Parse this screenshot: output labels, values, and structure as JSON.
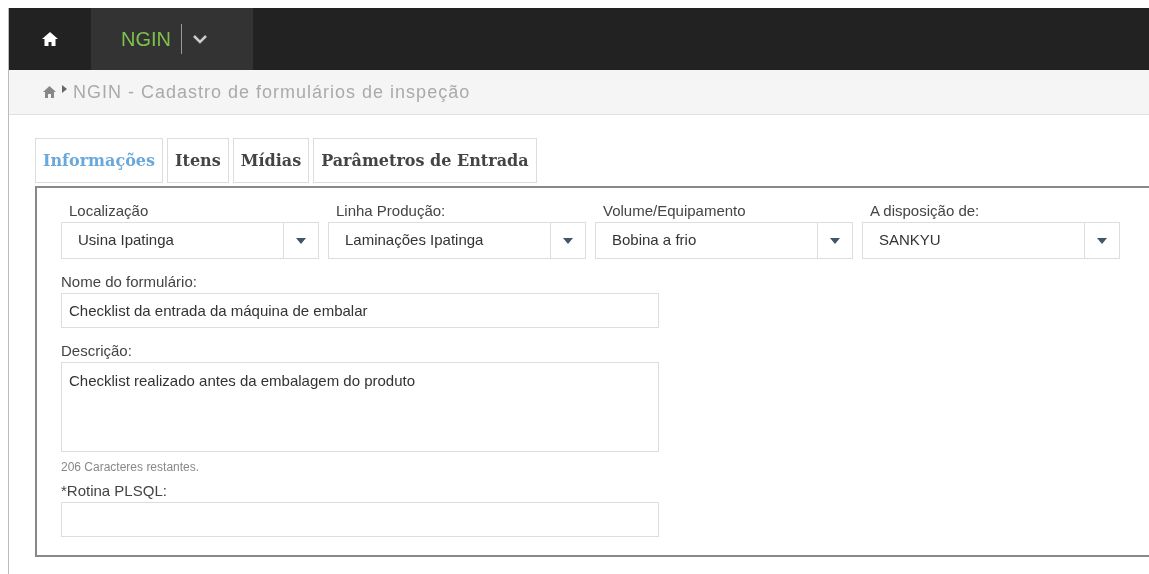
{
  "top_bar": {
    "module": "NGIN"
  },
  "breadcrumb": {
    "text": "NGIN - Cadastro de formulários de inspeção"
  },
  "tabs": [
    {
      "label": "Informações",
      "selected": true
    },
    {
      "label": "Itens",
      "selected": false
    },
    {
      "label": "Mídias",
      "selected": false
    },
    {
      "label": "Parâmetros de Entrada",
      "selected": false
    }
  ],
  "selects": [
    {
      "label": "Localização",
      "value": "Usina Ipatinga"
    },
    {
      "label": "Linha Produção:",
      "value": "Laminações Ipatinga"
    },
    {
      "label": "Volume/Equipamento",
      "value": "Bobina a frio"
    },
    {
      "label": "A disposição de:",
      "value": "SANKYU"
    }
  ],
  "form_name": {
    "label": "Nome do formulário:",
    "value": "Checklist da entrada da máquina de embalar"
  },
  "description": {
    "label": "Descrição:",
    "value": "Checklist realizado antes da embalagem do produto",
    "counter": "206 Caracteres restantes."
  },
  "plsql": {
    "label": "*Rotina PLSQL:"
  }
}
